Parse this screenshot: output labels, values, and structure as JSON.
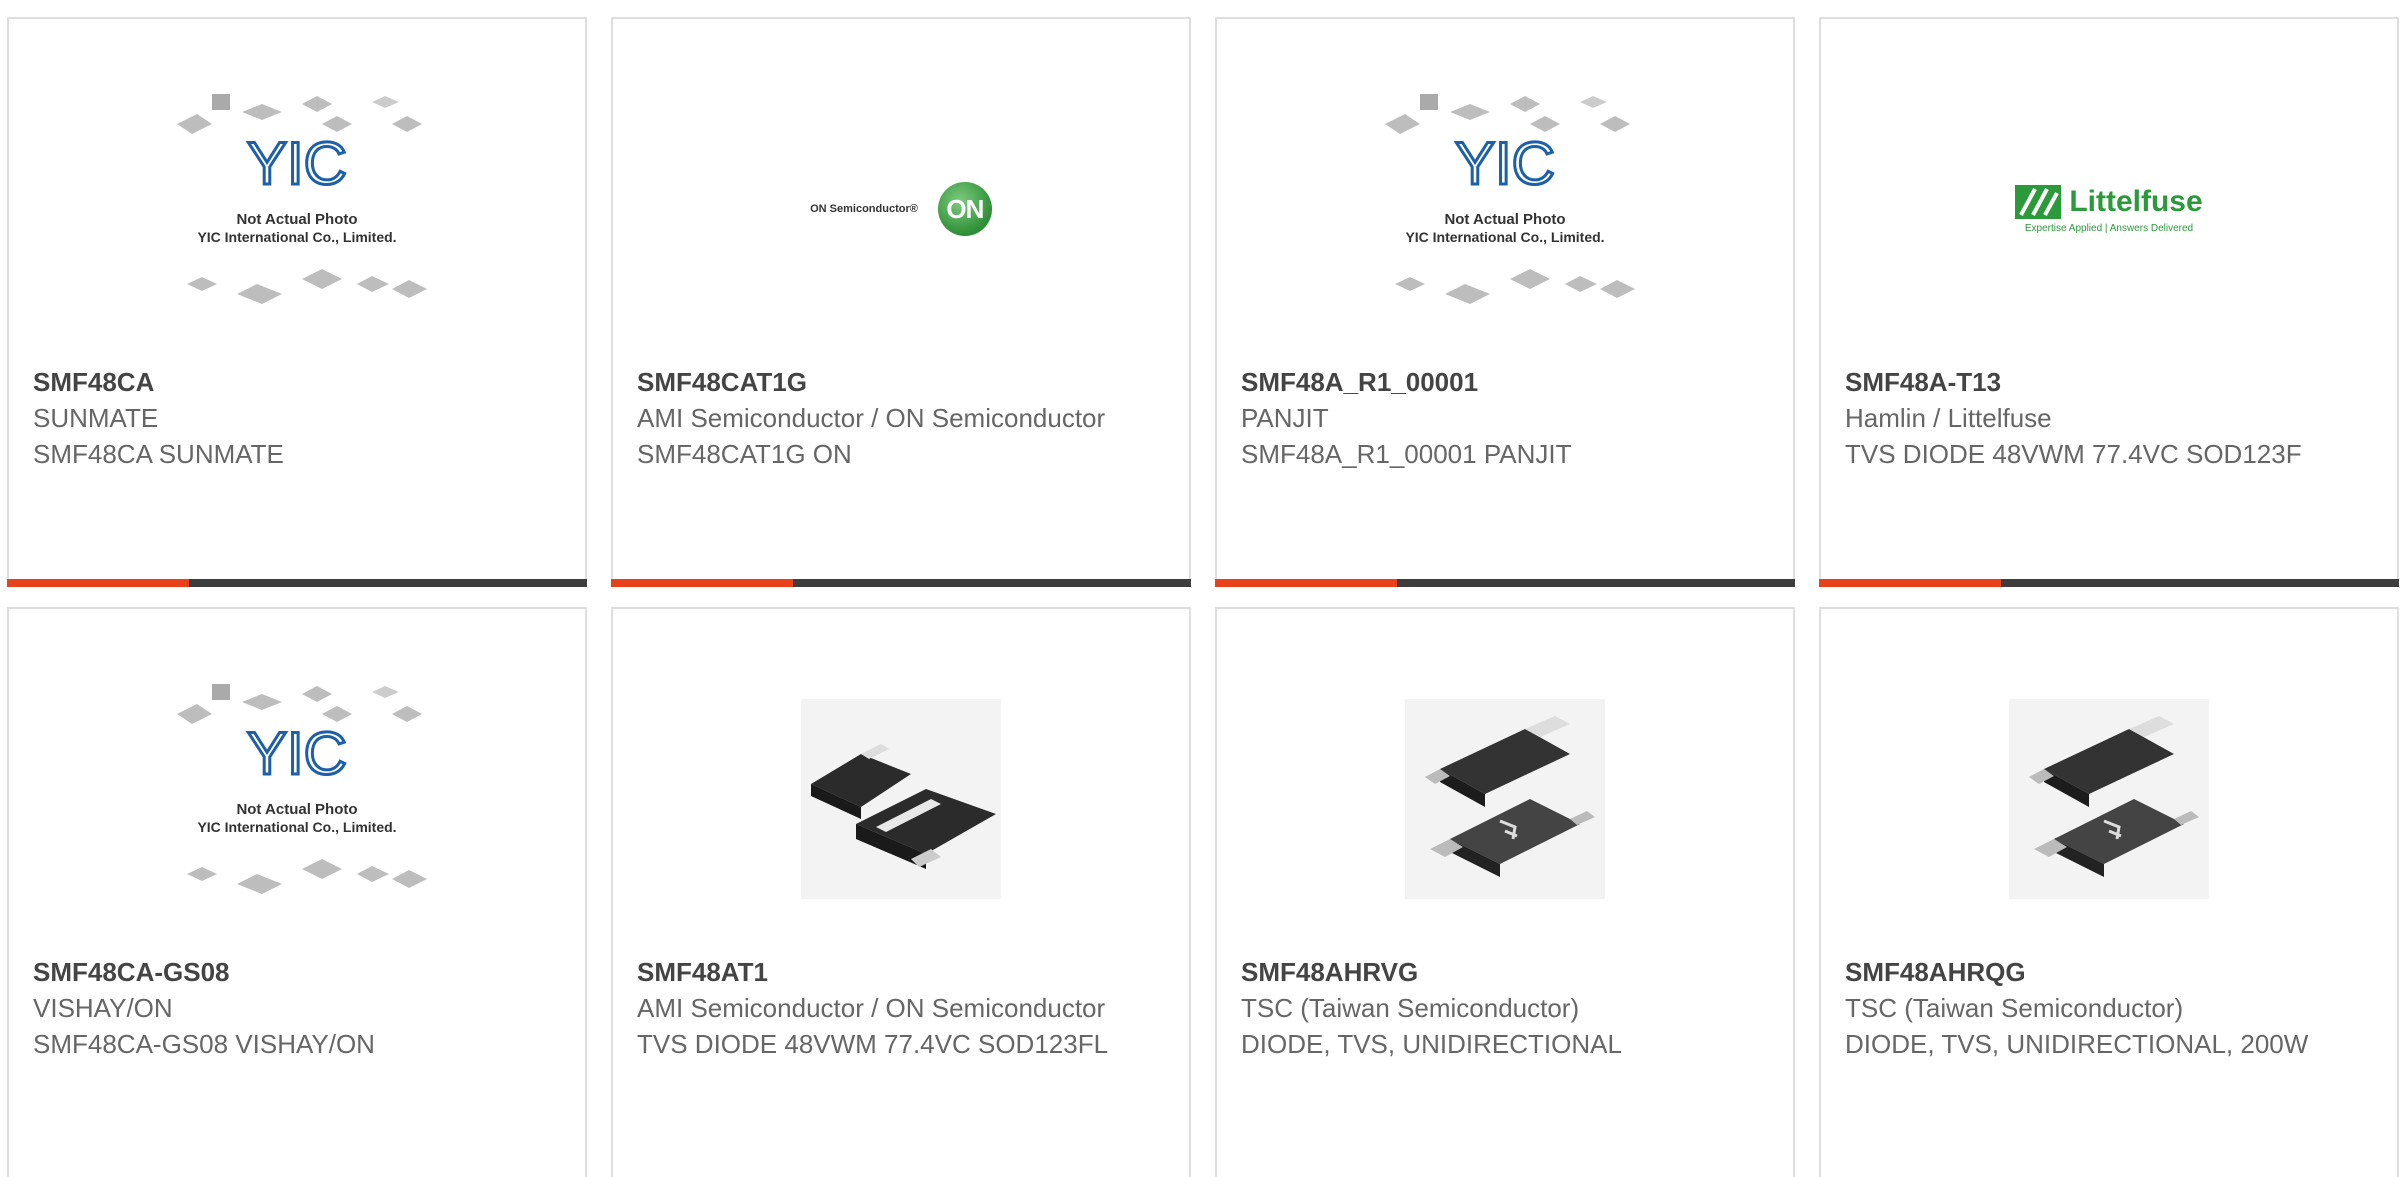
{
  "placeholder": {
    "line1": "Not Actual Photo",
    "line2": "YIC International Co., Limited.",
    "logo": "YIC"
  },
  "logos": {
    "on_text": "ON Semiconductor®",
    "on_badge": "ON",
    "littelfuse_word": "Littelfuse",
    "littelfuse_tag": "Expertise Applied | Answers Delivered"
  },
  "colors": {
    "accent": "#e9411b",
    "bar": "#3d3d3d",
    "border": "#dedede",
    "yic_blue": "#1d5fa8"
  },
  "cards": [
    {
      "part": "SMF48CA",
      "mfr": "SUNMATE",
      "desc": "SMF48CA SUNMATE",
      "image": "placeholder"
    },
    {
      "part": "SMF48CAT1G",
      "mfr": "AMI Semiconductor / ON Semiconductor",
      "desc": "SMF48CAT1G ON",
      "image": "on-logo"
    },
    {
      "part": "SMF48A_R1_00001",
      "mfr": "PANJIT",
      "desc": "SMF48A_R1_00001 PANJIT",
      "image": "placeholder"
    },
    {
      "part": "SMF48A-T13",
      "mfr": "Hamlin / Littelfuse",
      "desc": "TVS DIODE 48VWM 77.4VC SOD123F",
      "image": "littelfuse-logo"
    },
    {
      "part": "SMF48CA-GS08",
      "mfr": "VISHAY/ON",
      "desc": "SMF48CA-GS08 VISHAY/ON",
      "image": "placeholder"
    },
    {
      "part": "SMF48AT1",
      "mfr": "AMI Semiconductor / ON Semiconductor",
      "desc": "TVS DIODE 48VWM 77.4VC SOD123FL",
      "image": "sod-photo"
    },
    {
      "part": "SMF48AHRVG",
      "mfr": "TSC (Taiwan Semiconductor)",
      "desc": "DIODE, TVS, UNIDIRECTIONAL",
      "image": "tsc-photo"
    },
    {
      "part": "SMF48AHRQG",
      "mfr": "TSC (Taiwan Semiconductor)",
      "desc": "DIODE, TVS, UNIDIRECTIONAL, 200W",
      "image": "tsc-photo"
    }
  ]
}
